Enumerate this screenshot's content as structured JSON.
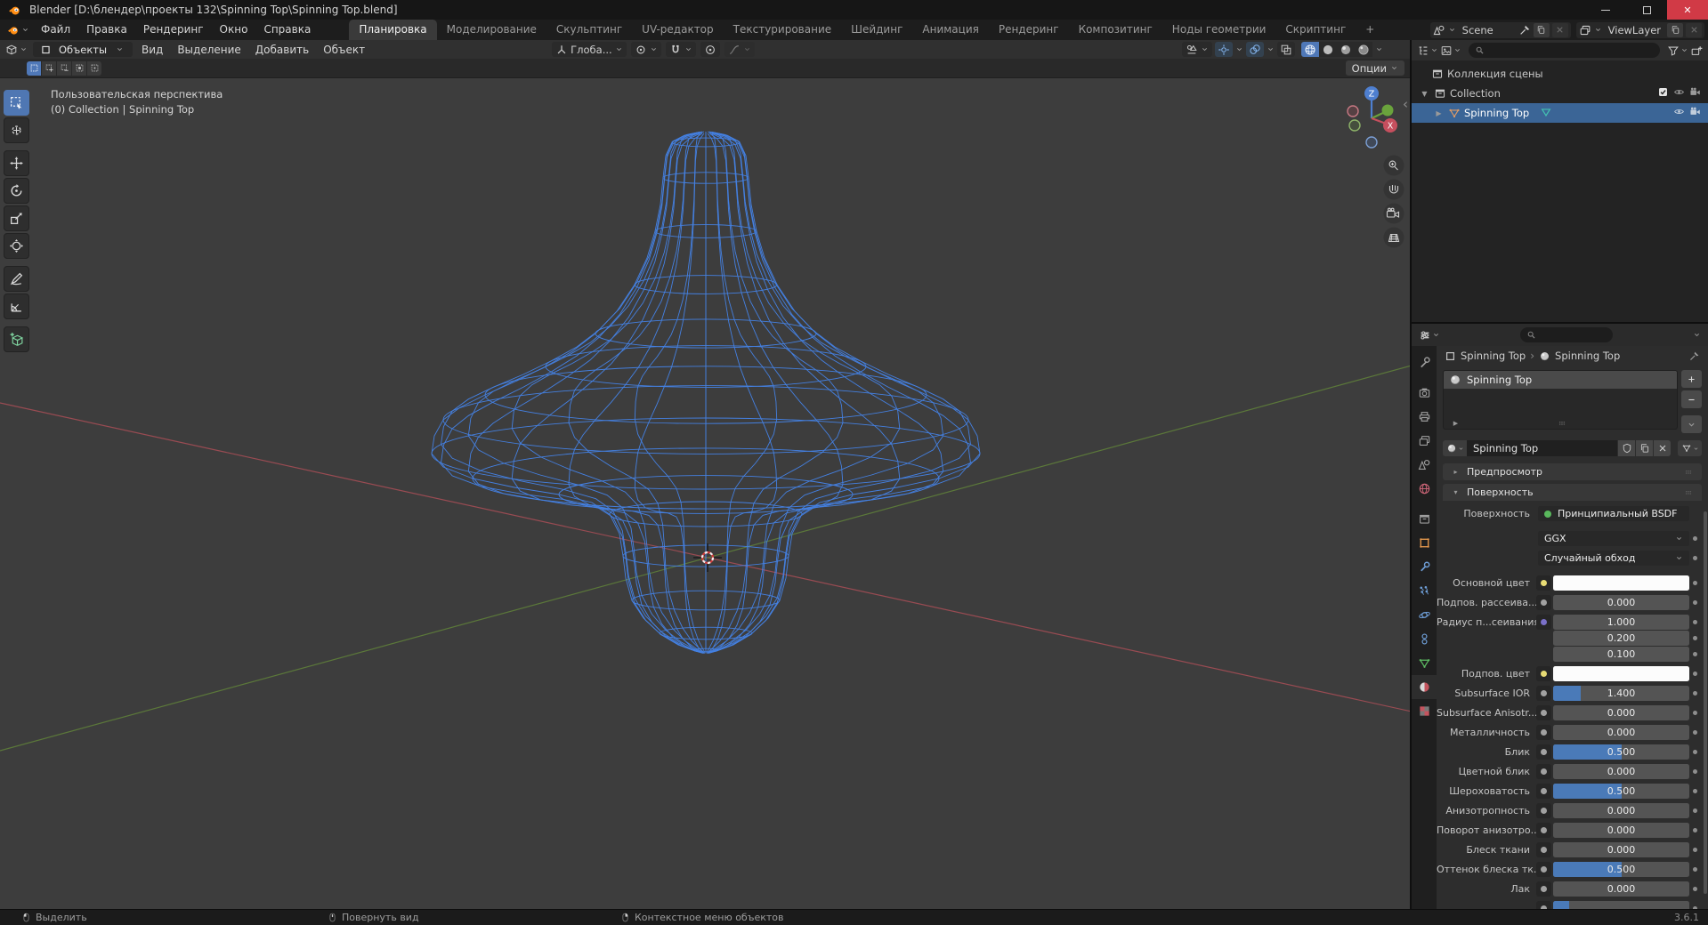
{
  "window": {
    "title": "Blender [D:\\блендер\\проекты 132\\Spinning Top\\Spinning Top.blend]"
  },
  "topbar": {
    "menus": [
      "Файл",
      "Правка",
      "Рендеринг",
      "Окно",
      "Справка"
    ],
    "workspaces": [
      "Планировка",
      "Моделирование",
      "Скульптинг",
      "UV-редактор",
      "Текстурирование",
      "Шейдинг",
      "Анимация",
      "Рендеринг",
      "Композитинг",
      "Ноды геометрии",
      "Скриптинг",
      "+"
    ],
    "active_workspace": "Планировка",
    "scene_selector": {
      "value": "Scene"
    },
    "view_layer_selector": {
      "value": "ViewLayer"
    }
  },
  "viewport": {
    "mode": "Объекты",
    "menus": [
      "Вид",
      "Выделение",
      "Добавить",
      "Объект"
    ],
    "orientation": "Глоба...",
    "options_button": "Опции",
    "overlay_line1": "Пользовательская перспектива",
    "overlay_line2": "(0) Collection | Spinning Top",
    "gizmo": {
      "z": "Z",
      "x": "X"
    },
    "select_modes": [
      "selmode-new-icon",
      "selmode-extend-icon",
      "selmode-subtract-icon",
      "selmode-invert-icon",
      "selmode-intersect-icon"
    ],
    "nav_buttons": [
      "zoom-view-button",
      "pan-view-button",
      "camera-view-button",
      "ortho-view-button"
    ]
  },
  "toolbar": [
    {
      "icon": "box-select-tool-icon",
      "active": true
    },
    {
      "icon": "cursor-tool-icon"
    },
    {
      "icon": "move-tool-icon",
      "gap": true
    },
    {
      "icon": "rotate-tool-icon"
    },
    {
      "icon": "scale-tool-icon"
    },
    {
      "icon": "transform-tool-icon"
    },
    {
      "icon": "annotate-tool-icon",
      "gap": true
    },
    {
      "icon": "measure-tool-icon"
    },
    {
      "icon": "add-cube-tool-icon",
      "gap": true
    }
  ],
  "outliner": {
    "rows": [
      {
        "label": "Коллекция сцены",
        "icon": "scene-collection-icon",
        "indent": 0
      },
      {
        "label": "Collection",
        "icon": "collection-icon",
        "indent": 1,
        "expanded": true,
        "toggles": [
          "checkbox",
          "eye",
          "camera"
        ]
      },
      {
        "label": "Spinning Top",
        "icon": "mesh-object-icon",
        "indent": 2,
        "selected": true,
        "extra_icon": "material-data-icon",
        "toggles": [
          "eye",
          "camera"
        ]
      }
    ]
  },
  "properties": {
    "tabs": [
      {
        "icon": "tool-icon"
      },
      {
        "icon": "render-icon",
        "gap": true
      },
      {
        "icon": "output-icon"
      },
      {
        "icon": "viewlayer-icon"
      },
      {
        "icon": "scene-icon"
      },
      {
        "icon": "world-icon"
      },
      {
        "icon": "collection-icon",
        "gap": true
      },
      {
        "icon": "object-icon"
      },
      {
        "icon": "modifier-icon"
      },
      {
        "icon": "particles-icon"
      },
      {
        "icon": "physics-icon"
      },
      {
        "icon": "constraints-icon"
      },
      {
        "icon": "data-icon"
      },
      {
        "icon": "material-icon",
        "active": true
      },
      {
        "icon": "texture-icon"
      }
    ],
    "breadcrumb": {
      "object": "Spinning Top",
      "data": "Spinning Top"
    },
    "slot_list": [
      {
        "name": "Spinning Top"
      }
    ],
    "material_field": {
      "name": "Spinning Top"
    },
    "panel_preview": "Предпросмотр",
    "panel_surface": "Поверхность",
    "rows": [
      {
        "label": "Поверхность",
        "type": "shader",
        "value": "Принципиальный BSDF"
      },
      {
        "label": "",
        "type": "select",
        "value": "GGX"
      },
      {
        "label": "",
        "type": "select",
        "value": "Случайный обход"
      },
      {
        "label": "Основной цвет",
        "type": "color",
        "socket_color": "#e7db74"
      },
      {
        "label": "Подпов. рассеива...",
        "type": "slider",
        "value": "0.000",
        "fill": 0,
        "socket_color": "#a1a1a1"
      },
      {
        "label": "Радиус п...сеивания",
        "type": "vector",
        "values": [
          "1.000",
          "0.200",
          "0.100"
        ],
        "socket_color": "#7a70c8"
      },
      {
        "label": "Подпов. цвет",
        "type": "color",
        "socket_color": "#e7db74"
      },
      {
        "label": "Subsurface IOR",
        "type": "slider",
        "value": "1.400",
        "fill": 0.2,
        "socket_color": "#a1a1a1"
      },
      {
        "label": "Subsurface Anisotr...",
        "type": "slider",
        "value": "0.000",
        "fill": 0,
        "socket_color": "#a1a1a1"
      },
      {
        "label": "Металличность",
        "type": "slider",
        "value": "0.000",
        "fill": 0,
        "socket_color": "#a1a1a1"
      },
      {
        "label": "Блик",
        "type": "slider",
        "value": "0.500",
        "fill": 0.5,
        "socket_color": "#a1a1a1"
      },
      {
        "label": "Цветной блик",
        "type": "slider",
        "value": "0.000",
        "fill": 0,
        "socket_color": "#a1a1a1"
      },
      {
        "label": "Шероховатость",
        "type": "slider",
        "value": "0.500",
        "fill": 0.5,
        "socket_color": "#a1a1a1"
      },
      {
        "label": "Анизотропность",
        "type": "slider",
        "value": "0.000",
        "fill": 0,
        "socket_color": "#a1a1a1"
      },
      {
        "label": "Поворот анизотро...",
        "type": "slider",
        "value": "0.000",
        "fill": 0,
        "socket_color": "#a1a1a1"
      },
      {
        "label": "Блеск ткани",
        "type": "slider",
        "value": "0.000",
        "fill": 0,
        "socket_color": "#a1a1a1"
      },
      {
        "label": "Оттенок блеска тк...",
        "type": "slider",
        "value": "0.500",
        "fill": 0.5,
        "socket_color": "#a1a1a1"
      },
      {
        "label": "Лак",
        "type": "slider",
        "value": "0.000",
        "fill": 0,
        "socket_color": "#a1a1a1"
      },
      {
        "label": "",
        "type": "slider",
        "value": "",
        "fill": 0.12,
        "socket_color": "#a1a1a1"
      }
    ]
  },
  "statusbar": {
    "hints": [
      {
        "icon": "mouse-left-icon",
        "label": "Выделить"
      },
      {
        "icon": "mouse-middle-icon",
        "label": "Повернуть вид"
      },
      {
        "icon": "mouse-right-icon",
        "label": "Контекстное меню объектов"
      }
    ],
    "version": "3.6.1"
  },
  "colors": {
    "accent": "#4772b3",
    "wire": "#4584ea",
    "selection": "#3b6596",
    "axis_x": "#a34d55",
    "axis_y": "#5f7f3a"
  }
}
